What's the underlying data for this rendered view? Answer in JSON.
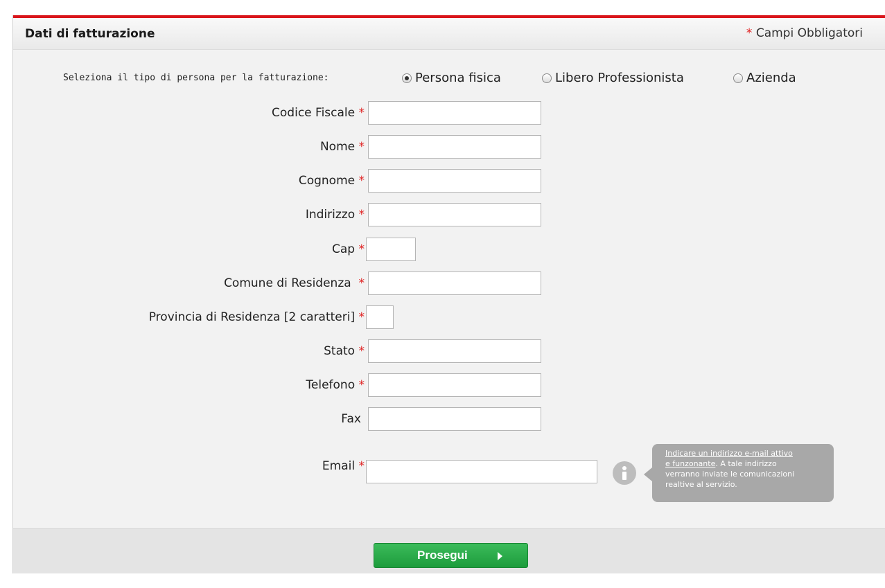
{
  "header": {
    "title": "Dati di fatturazione",
    "required_star": "*",
    "required_note": "Campi Obbligatori"
  },
  "person_type": {
    "label": "Seleziona il tipo di persona per la fatturazione:",
    "options": [
      {
        "label": "Persona fisica",
        "selected": true
      },
      {
        "label": "Libero Professionista",
        "selected": false
      },
      {
        "label": "Azienda",
        "selected": false
      }
    ]
  },
  "fields": [
    {
      "label": "Codice Fiscale",
      "required": "*",
      "value": ""
    },
    {
      "label": "Nome",
      "required": "*",
      "value": ""
    },
    {
      "label": "Cognome",
      "required": "*",
      "value": ""
    },
    {
      "label": "Indirizzo",
      "required": "*",
      "value": ""
    },
    {
      "label": "Cap",
      "required": "*",
      "value": ""
    },
    {
      "label": "Comune di Residenza",
      "required": "*",
      "value": ""
    },
    {
      "label": "Provincia di Residenza [2 caratteri]",
      "required": "*",
      "value": ""
    },
    {
      "label": "Stato",
      "required": "*",
      "value": ""
    },
    {
      "label": "Telefono",
      "required": "*",
      "value": ""
    },
    {
      "label": "Fax",
      "required": "",
      "value": ""
    },
    {
      "label": "Email",
      "required": "*",
      "value": ""
    }
  ],
  "email_tooltip": {
    "line1": "Indicare un indirizzo e-mail attivo",
    "line2_underlined": "e funzonante",
    "line2_rest": ". A tale indirizzo",
    "line3": "verranno inviate le comunicazioni",
    "line4": "realtive al servizio."
  },
  "footer": {
    "continue_label": "Prosegui"
  },
  "colors": {
    "accent_red": "#d9151b",
    "button_green": "#1d9c3c",
    "panel_bg": "#f2f2f2"
  },
  "icons": {
    "info": "info-icon",
    "arrow": "arrow-right-icon"
  }
}
